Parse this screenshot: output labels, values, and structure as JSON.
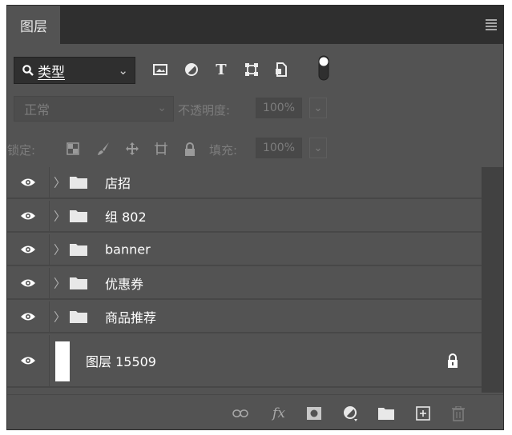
{
  "tab": {
    "label": "图层"
  },
  "filter": {
    "label": "类型",
    "icons": [
      "image-filter-icon",
      "adjustment-filter-icon",
      "type-filter-icon",
      "shape-filter-icon",
      "smart-object-filter-icon",
      "filter-toggle-icon"
    ]
  },
  "blend": {
    "mode": "正常",
    "opacity_label": "不透明度:",
    "opacity_value": "100%"
  },
  "lock": {
    "label": "锁定:",
    "fill_label": "填充:",
    "fill_value": "100%"
  },
  "layers": [
    {
      "name": "店招",
      "type": "group"
    },
    {
      "name": "组 802",
      "type": "group"
    },
    {
      "name": "banner",
      "type": "group"
    },
    {
      "name": "优惠券",
      "type": "group"
    },
    {
      "name": "商品推荐",
      "type": "group"
    },
    {
      "name": "图层 15509",
      "type": "layer",
      "locked": true
    }
  ],
  "bottom_icons": [
    "link-icon",
    "fx-icon",
    "mask-icon",
    "adjustment-icon",
    "new-group-icon",
    "new-layer-icon",
    "trash-icon"
  ],
  "colors": {
    "panel_bg": "#535353",
    "dark_bg": "#2f2f2f",
    "text": "#ffffff",
    "dim_text": "#7c7c7c"
  }
}
